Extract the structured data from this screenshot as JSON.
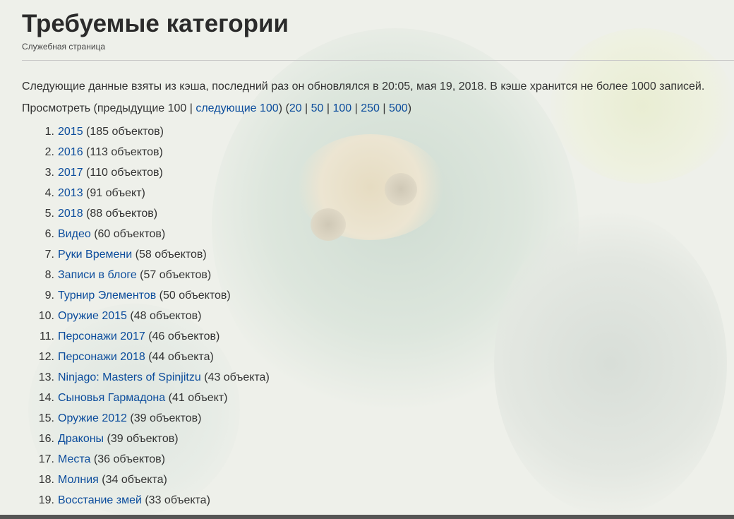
{
  "page": {
    "title": "Требуемые категории",
    "subtitle": "Служебная страница",
    "intro": "Следующие данные взяты из кэша, последний раз он обновлялся в 20:05, мая 19, 2018. В кэше хранится не более 1000 записей."
  },
  "nav": {
    "prefix": "Просмотреть (предыдущие 100 | ",
    "next_label": "следующие 100",
    "mid": ") (",
    "sizes": [
      "20",
      "50",
      "100",
      "250",
      "500"
    ],
    "sep": " | ",
    "suffix": ")"
  },
  "categories": [
    {
      "num": "1.",
      "name": "2015",
      "count": " (185 объектов)"
    },
    {
      "num": "2.",
      "name": "2016",
      "count": " (113 объектов)"
    },
    {
      "num": "3.",
      "name": "2017",
      "count": " (110 объектов)"
    },
    {
      "num": "4.",
      "name": "2013",
      "count": " (91 объект)"
    },
    {
      "num": "5.",
      "name": "2018",
      "count": " (88 объектов)"
    },
    {
      "num": "6.",
      "name": "Видео",
      "count": " (60 объектов)"
    },
    {
      "num": "7.",
      "name": "Руки Времени",
      "count": " (58 объектов)"
    },
    {
      "num": "8.",
      "name": "Записи в блоге",
      "count": " (57 объектов)"
    },
    {
      "num": "9.",
      "name": "Турнир Элементов",
      "count": " (50 объектов)"
    },
    {
      "num": "10.",
      "name": "Оружие 2015",
      "count": " (48 объектов)"
    },
    {
      "num": "11.",
      "name": "Персонажи 2017",
      "count": " (46 объектов)"
    },
    {
      "num": "12.",
      "name": "Персонажи 2018",
      "count": " (44 объекта)"
    },
    {
      "num": "13.",
      "name": "Ninjago: Masters of Spinjitzu",
      "count": " (43 объекта)"
    },
    {
      "num": "14.",
      "name": "Сыновья Гармадона",
      "count": " (41 объект)"
    },
    {
      "num": "15.",
      "name": "Оружие 2012",
      "count": " (39 объектов)"
    },
    {
      "num": "16.",
      "name": "Драконы",
      "count": " (39 объектов)"
    },
    {
      "num": "17.",
      "name": "Места",
      "count": " (36 объектов)"
    },
    {
      "num": "18.",
      "name": "Молния",
      "count": " (34 объекта)"
    },
    {
      "num": "19.",
      "name": "Восстание змей",
      "count": " (33 объекта)"
    }
  ]
}
